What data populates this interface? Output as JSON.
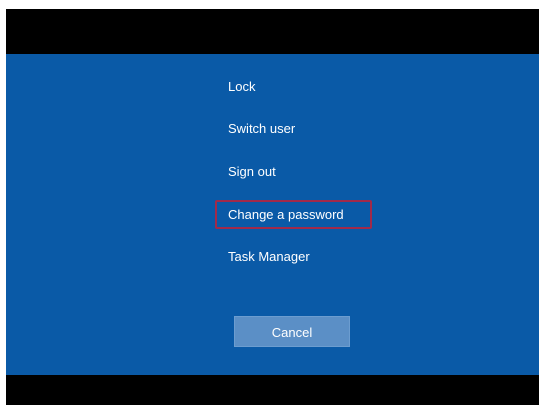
{
  "options": {
    "lock": "Lock",
    "switch_user": "Switch user",
    "sign_out": "Sign out",
    "change_password": "Change a password",
    "task_manager": "Task Manager"
  },
  "highlighted_option": "change_password",
  "cancel_label": "Cancel",
  "colors": {
    "panel_background": "#0a5aa7",
    "letterbox": "#000000",
    "highlight_border": "#a12a4a",
    "cancel_button": "#5b8fc6",
    "text": "#ffffff"
  }
}
